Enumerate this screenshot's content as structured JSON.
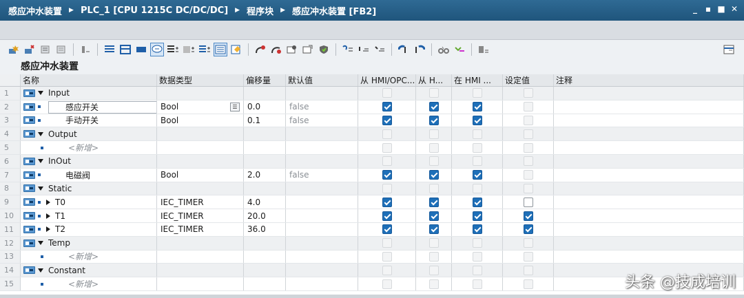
{
  "titlebar": {
    "crumbs": [
      "感应冲水装置",
      "PLC_1 [CPU 1215C DC/DC/DC]",
      "程序块",
      "感应冲水装置 [FB2]"
    ],
    "window_controls": [
      "minimize-icon",
      "restore-icon",
      "maximize-icon",
      "close-icon"
    ]
  },
  "block_title": "感应冲水装置",
  "columns": {
    "name": "名称",
    "type": "数据类型",
    "offset": "偏移量",
    "default": "默认值",
    "hmi_opc": "从 HMI/OPC...",
    "hmi_h": "从 H...",
    "hmi_in": "在 HMI ...",
    "setpoint": "设定值",
    "comment": "注释"
  },
  "rows": [
    {
      "num": "1",
      "kind": "group",
      "name": "Input",
      "type": "",
      "offset": "",
      "default": "",
      "hmi1": "dis",
      "hmi2": "dis",
      "hmi3": "dis",
      "set": "dis"
    },
    {
      "num": "2",
      "kind": "var",
      "name": "感应开关",
      "type": "Bool",
      "offset": "0.0",
      "default": "false",
      "hmi1": "on",
      "hmi2": "on",
      "hmi3": "on",
      "set": "dis",
      "editing": true
    },
    {
      "num": "3",
      "kind": "var",
      "name": "手动开关",
      "type": "Bool",
      "offset": "0.1",
      "default": "false",
      "hmi1": "on",
      "hmi2": "on",
      "hmi3": "on",
      "set": "dis"
    },
    {
      "num": "4",
      "kind": "group",
      "name": "Output",
      "type": "",
      "offset": "",
      "default": "",
      "hmi1": "dis",
      "hmi2": "dis",
      "hmi3": "dis",
      "set": "dis"
    },
    {
      "num": "5",
      "kind": "add",
      "name": "<新增>",
      "type": "",
      "offset": "",
      "default": "",
      "hmi1": "dis",
      "hmi2": "dis",
      "hmi3": "dis",
      "set": "dis"
    },
    {
      "num": "6",
      "kind": "group",
      "name": "InOut",
      "type": "",
      "offset": "",
      "default": "",
      "hmi1": "dis",
      "hmi2": "dis",
      "hmi3": "dis",
      "set": "dis"
    },
    {
      "num": "7",
      "kind": "var",
      "name": "电磁阀",
      "type": "Bool",
      "offset": "2.0",
      "default": "false",
      "hmi1": "on",
      "hmi2": "on",
      "hmi3": "on",
      "set": "dis"
    },
    {
      "num": "8",
      "kind": "group",
      "name": "Static",
      "type": "",
      "offset": "",
      "default": "",
      "hmi1": "dis",
      "hmi2": "dis",
      "hmi3": "dis",
      "set": "dis"
    },
    {
      "num": "9",
      "kind": "struct",
      "name": "T0",
      "type": "IEC_TIMER",
      "offset": "4.0",
      "default": "",
      "hmi1": "on",
      "hmi2": "on",
      "hmi3": "on",
      "set": "en"
    },
    {
      "num": "10",
      "kind": "struct",
      "name": "T1",
      "type": "IEC_TIMER",
      "offset": "20.0",
      "default": "",
      "hmi1": "on",
      "hmi2": "on",
      "hmi3": "on",
      "set": "on"
    },
    {
      "num": "11",
      "kind": "struct",
      "name": "T2",
      "type": "IEC_TIMER",
      "offset": "36.0",
      "default": "",
      "hmi1": "on",
      "hmi2": "on",
      "hmi3": "on",
      "set": "on"
    },
    {
      "num": "12",
      "kind": "group",
      "name": "Temp",
      "type": "",
      "offset": "",
      "default": "",
      "hmi1": "dis",
      "hmi2": "dis",
      "hmi3": "dis",
      "set": "dis"
    },
    {
      "num": "13",
      "kind": "add",
      "name": "<新增>",
      "type": "",
      "offset": "",
      "default": "",
      "hmi1": "dis",
      "hmi2": "dis",
      "hmi3": "dis",
      "set": "dis"
    },
    {
      "num": "14",
      "kind": "group",
      "name": "Constant",
      "type": "",
      "offset": "",
      "default": "",
      "hmi1": "dis",
      "hmi2": "dis",
      "hmi3": "dis",
      "set": "dis"
    },
    {
      "num": "15",
      "kind": "add",
      "name": "<新增>",
      "type": "",
      "offset": "",
      "default": "",
      "hmi1": "dis",
      "hmi2": "dis",
      "hmi3": "dis",
      "set": "dis"
    }
  ],
  "watermark": "头条 @技成培训",
  "colors": {
    "titlebar": "#1f557c",
    "checkbox_checked": "#1e6fb8",
    "interface_icon": "#5a97d0"
  }
}
